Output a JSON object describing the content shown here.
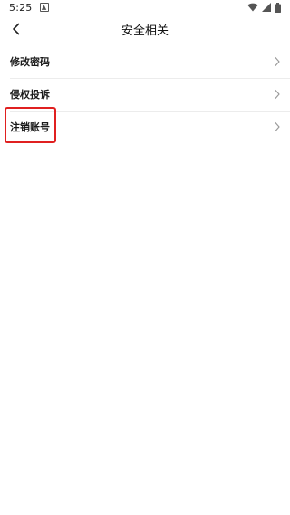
{
  "status_bar": {
    "time": "5:25",
    "notification_icon": "download-notification-icon",
    "icons": [
      "wifi-icon",
      "signal-icon",
      "battery-icon"
    ]
  },
  "header": {
    "back_icon": "chevron-left-icon",
    "title": "安全相关"
  },
  "menu": {
    "items": [
      {
        "label": "修改密码",
        "icon": "chevron-right-icon"
      },
      {
        "label": "侵权投诉",
        "icon": "chevron-right-icon"
      },
      {
        "label": "注销账号",
        "icon": "chevron-right-icon",
        "highlighted": true
      }
    ]
  },
  "colors": {
    "highlight": "#e02020",
    "divider": "#ececec",
    "chevron": "#9a9a9a"
  }
}
